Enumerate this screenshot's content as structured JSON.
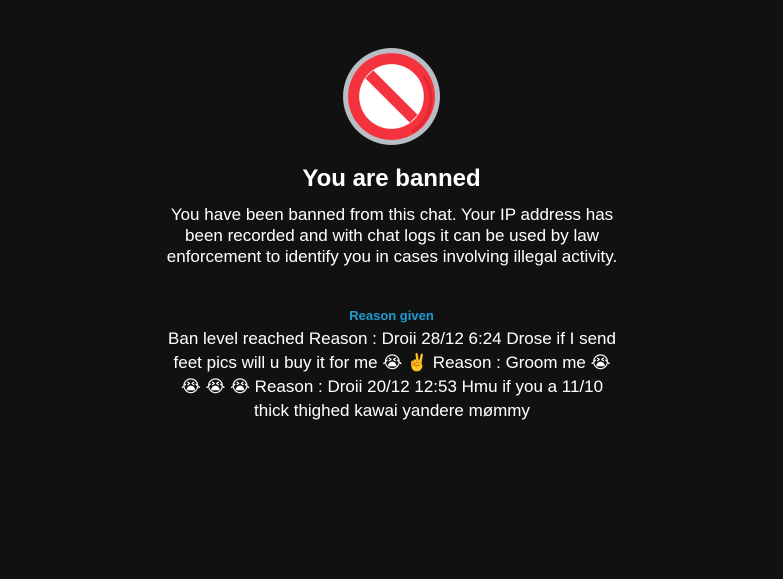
{
  "banned": {
    "icon": "prohibited-icon",
    "title": "You are banned",
    "description": "You have been banned from this chat. Your IP address has been recorded and with chat logs it can be used by law enforcement to identify you in cases involving illegal activity.",
    "reason_label": "Reason given",
    "reason_text": "Ban level reached Reason : Droii 28/12 6:24 Drose if I send feet pics will u buy it for me 😭 ✌️ Reason : Groom me 😭 😭 😭 😭 Reason : Droii 20/12 12:53 Hmu if you a 11/10 thick thighed kawai yandere mømmy"
  },
  "colors": {
    "background": "#111112",
    "accent": "#1d9bd1",
    "icon_red": "#f4333f",
    "icon_ring": "#b9bec4"
  }
}
